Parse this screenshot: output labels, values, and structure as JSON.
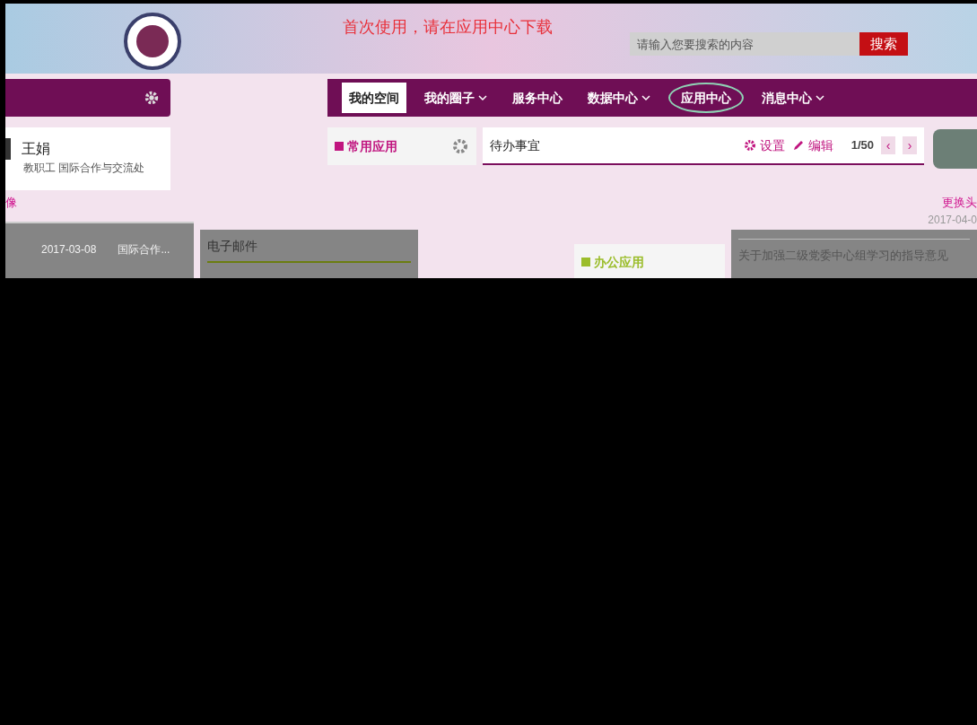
{
  "header": {
    "notice": "首次使用，请在应用中心下载",
    "search": {
      "placeholder": "请输入您要搜索的内容"
    },
    "search_button": "搜索"
  },
  "nav": {
    "items": [
      {
        "label": "我的空间",
        "selected": true,
        "dropdown": false,
        "circled": false
      },
      {
        "label": "我的圈子",
        "selected": false,
        "dropdown": true,
        "circled": false
      },
      {
        "label": "服务中心",
        "selected": false,
        "dropdown": false,
        "circled": false
      },
      {
        "label": "数据中心",
        "selected": false,
        "dropdown": true,
        "circled": false
      },
      {
        "label": "应用中心",
        "selected": false,
        "dropdown": false,
        "circled": true
      },
      {
        "label": "消息中心",
        "selected": false,
        "dropdown": true,
        "circled": false
      }
    ]
  },
  "user": {
    "name": "王娟",
    "department": "教职工 国际合作与交流处",
    "link_fragment": "像"
  },
  "left_list": {
    "date": "2017-03-08",
    "title": "国际合作..."
  },
  "mail_panel": {
    "title": "电子邮件"
  },
  "apps_panel": {
    "title": "常用应用"
  },
  "todo_panel": {
    "title": "待办事宜",
    "settings": "设置",
    "edit": "编辑",
    "page": "1/50",
    "prev": "‹",
    "next": "›"
  },
  "right": {
    "change_avatar": "更换头",
    "date": "2017-04-0"
  },
  "office_panel": {
    "title": "办公应用"
  },
  "notice_list": {
    "items": [
      "关于加强二级党委中心组学习的指导意见"
    ]
  }
}
